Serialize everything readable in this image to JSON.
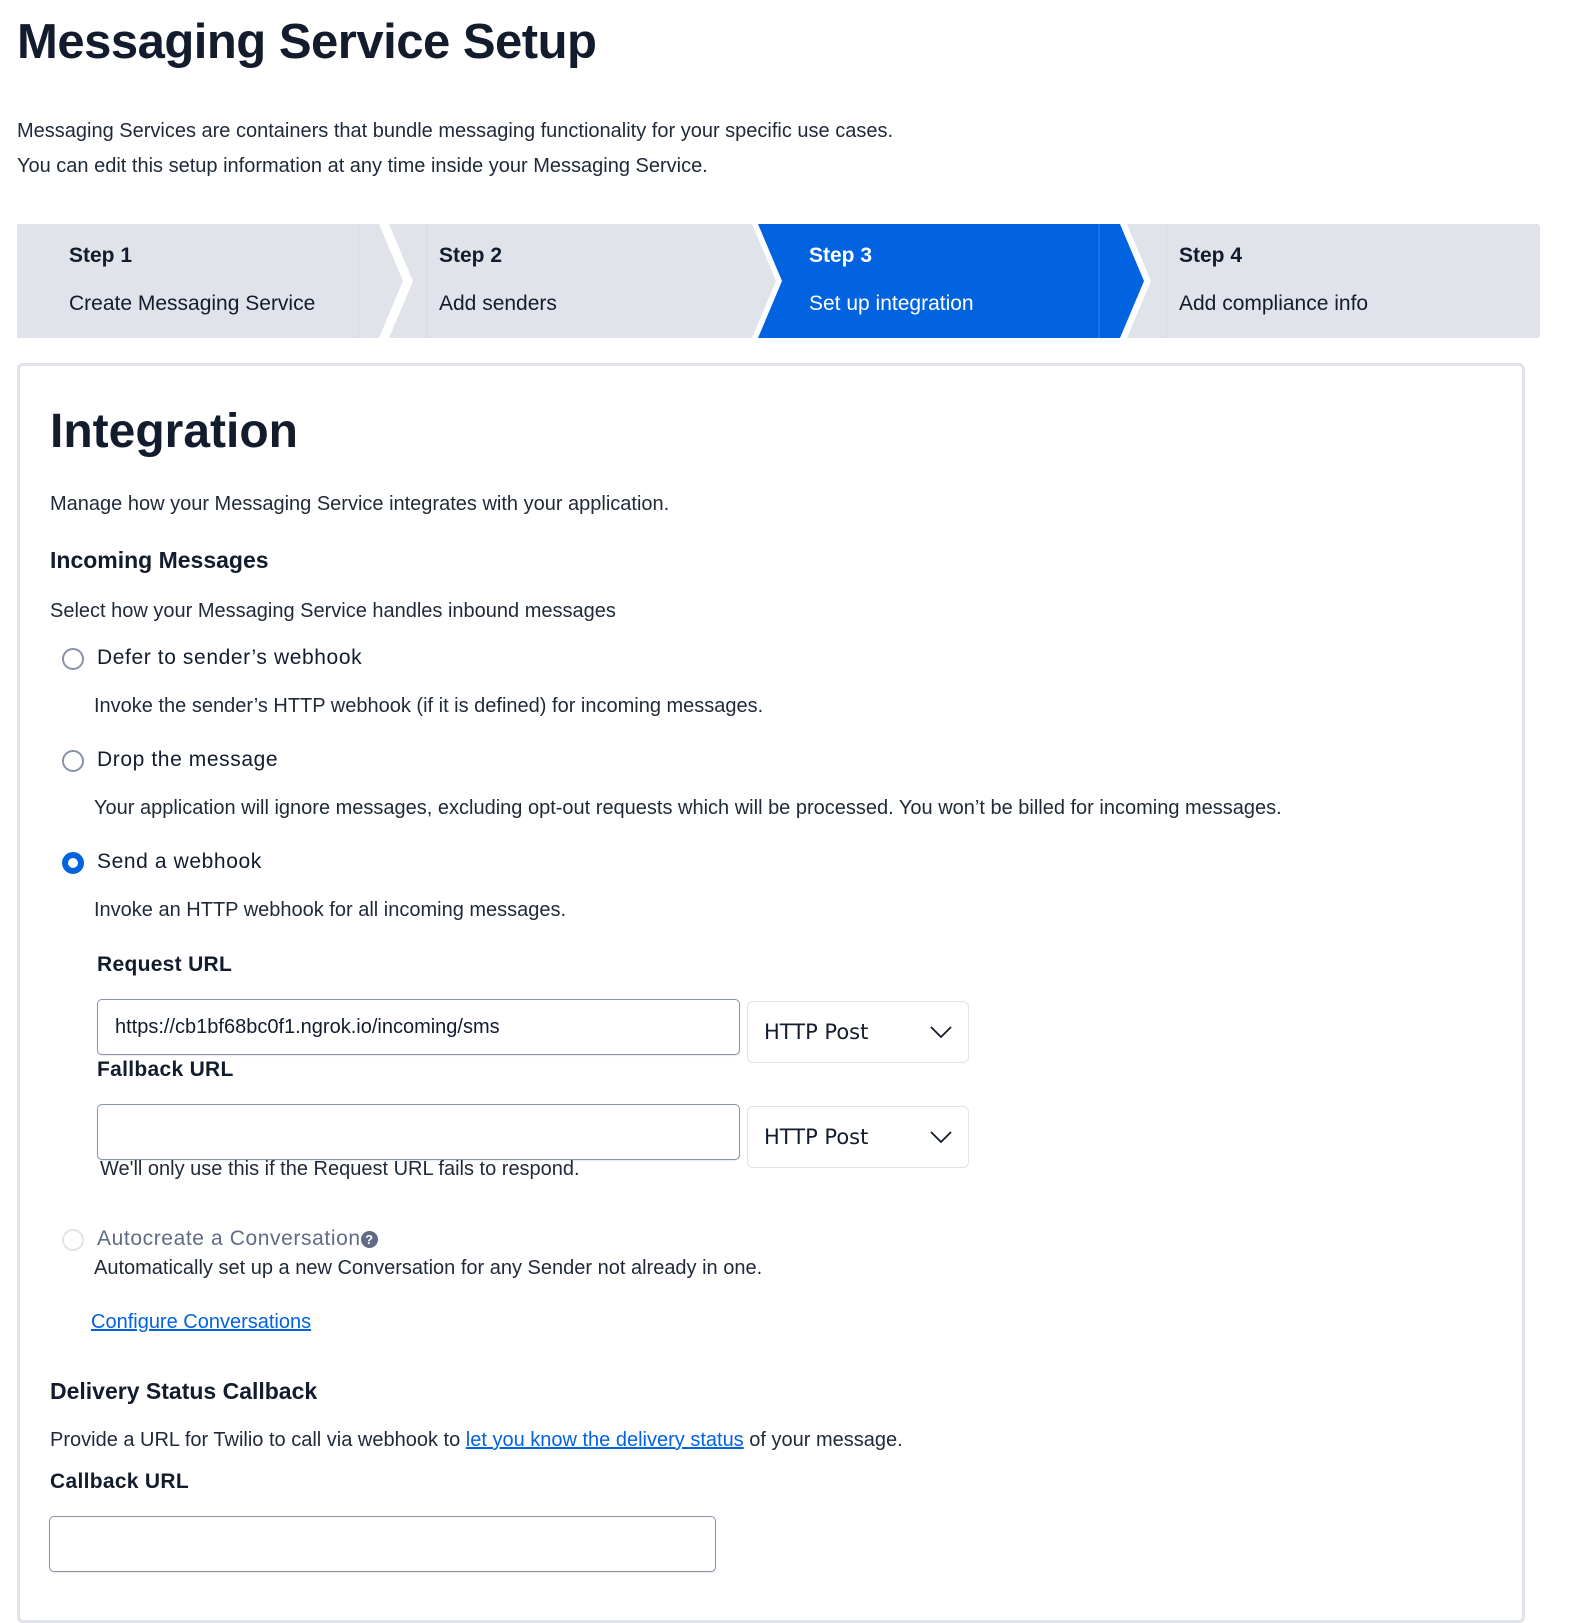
{
  "header": {
    "title": "Messaging Service Setup",
    "intro_line1": "Messaging Services are containers that bundle messaging functionality for your specific use cases.",
    "intro_line2": "You can edit this setup information at any time inside your Messaging Service."
  },
  "stepper": {
    "active_index": 2,
    "colors": {
      "active": "#0263e0",
      "inactive": "#e1e3ea"
    },
    "steps": [
      {
        "number": "Step 1",
        "label": "Create Messaging Service"
      },
      {
        "number": "Step 2",
        "label": "Add senders"
      },
      {
        "number": "Step 3",
        "label": "Set up integration"
      },
      {
        "number": "Step 4",
        "label": "Add compliance info"
      }
    ]
  },
  "integration": {
    "title": "Integration",
    "description": "Manage how your Messaging Service integrates with your application.",
    "incoming": {
      "heading": "Incoming Messages",
      "prompt": "Select how your Messaging Service handles inbound messages",
      "options": [
        {
          "label": "Defer to sender’s webhook",
          "description": "Invoke the sender’s HTTP webhook (if it is defined) for incoming messages.",
          "selected": false
        },
        {
          "label": "Drop the message",
          "description": "Your application will ignore messages, excluding opt-out requests which will be processed. You won’t be billed for incoming messages.",
          "selected": false
        },
        {
          "label": "Send a webhook",
          "description": "Invoke an HTTP webhook for all incoming messages.",
          "selected": true
        }
      ],
      "request_url": {
        "label": "Request URL",
        "value": "https://cb1bf68bc0f1.ngrok.io/incoming/sms",
        "method": "HTTP Post"
      },
      "fallback_url": {
        "label": "Fallback URL",
        "value": "",
        "method": "HTTP Post",
        "help": "We'll only use this if the Request URL fails to respond."
      },
      "autocreate": {
        "label": "Autocreate a Conversation",
        "help_icon": "question-circle-icon",
        "description": "Automatically set up a new Conversation for any Sender not already in one.",
        "disabled": true,
        "selected": false
      },
      "configure_link": "Configure Conversations"
    },
    "delivery": {
      "heading": "Delivery Status Callback",
      "text_before": "Provide a URL for Twilio to call via webhook to ",
      "link": "let you know the delivery status",
      "text_after": " of your message.",
      "callback_label": "Callback URL",
      "callback_value": ""
    }
  }
}
